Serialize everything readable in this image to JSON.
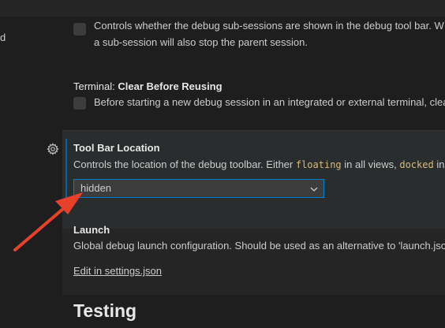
{
  "sidebar": {
    "fragment": "d"
  },
  "prev_setting": {
    "desc_line1": "Controls whether the debug sub-sessions are shown in the debug tool bar. W",
    "desc_line2": "a sub-session will also stop the parent session."
  },
  "terminal_setting": {
    "category": "Terminal: ",
    "name": "Clear Before Reusing",
    "desc": "Before starting a new debug session in an integrated or external terminal, clea"
  },
  "toolbar_setting": {
    "name": "Tool Bar Location",
    "desc_prefix": "Controls the location of the debug toolbar. Either ",
    "code1": "floating",
    "desc_mid": " in all views, ",
    "code2": "docked",
    "desc_suffix": " in",
    "value": "hidden"
  },
  "launch_setting": {
    "name": "Launch",
    "desc": "Global debug launch configuration. Should be used as an alternative to 'launch.jso",
    "link": "Edit in settings.json"
  },
  "section": {
    "title": "Testing"
  },
  "colors": {
    "accent": "#007fd4",
    "annotation_arrow": "#e8412b"
  },
  "icons": {
    "gear": "gear-icon",
    "chevron": "chevron-down-icon"
  }
}
